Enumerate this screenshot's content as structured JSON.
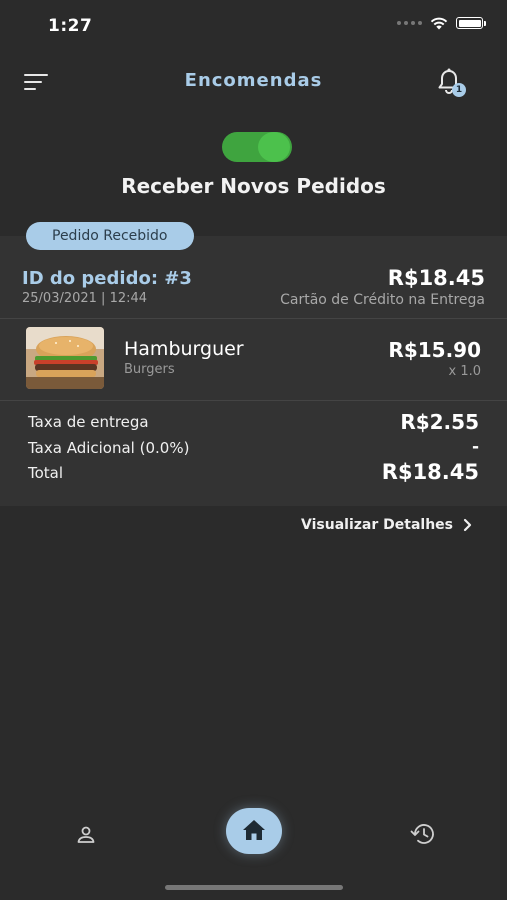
{
  "status_bar": {
    "time": "1:27"
  },
  "header": {
    "title": "Encomendas",
    "notification_count": "1"
  },
  "toggle": {
    "label": "Receber Novos Pedidos",
    "on": true,
    "color": "#3fa43f"
  },
  "order": {
    "status": "Pedido Recebido",
    "id": "ID do pedido: #3",
    "date": "25/03/2021 | 12:44",
    "total": "R$18.45",
    "payment_method": "Cartão de Crédito na Entrega",
    "items": [
      {
        "name": "Hamburguer",
        "category": "Burgers",
        "price": "R$15.90",
        "quantity": "x 1.0",
        "image": "burger-image"
      }
    ],
    "fees": [
      {
        "label": "Taxa de entrega",
        "value": "R$2.55"
      },
      {
        "label": "Taxa Adicional (0.0%)",
        "value": "-"
      },
      {
        "label": "Total",
        "value": "R$18.45"
      }
    ],
    "details_link": "Visualizar Detalhes"
  },
  "bottom_nav": {
    "items": [
      {
        "name": "profile",
        "icon": "user-icon"
      },
      {
        "name": "home",
        "icon": "home-icon",
        "active": true
      },
      {
        "name": "history",
        "icon": "history-icon"
      }
    ]
  },
  "colors": {
    "accent": "#a9cce8",
    "background": "#2b2b2b",
    "card": "#333333",
    "toggle_on": "#3fa43f"
  }
}
